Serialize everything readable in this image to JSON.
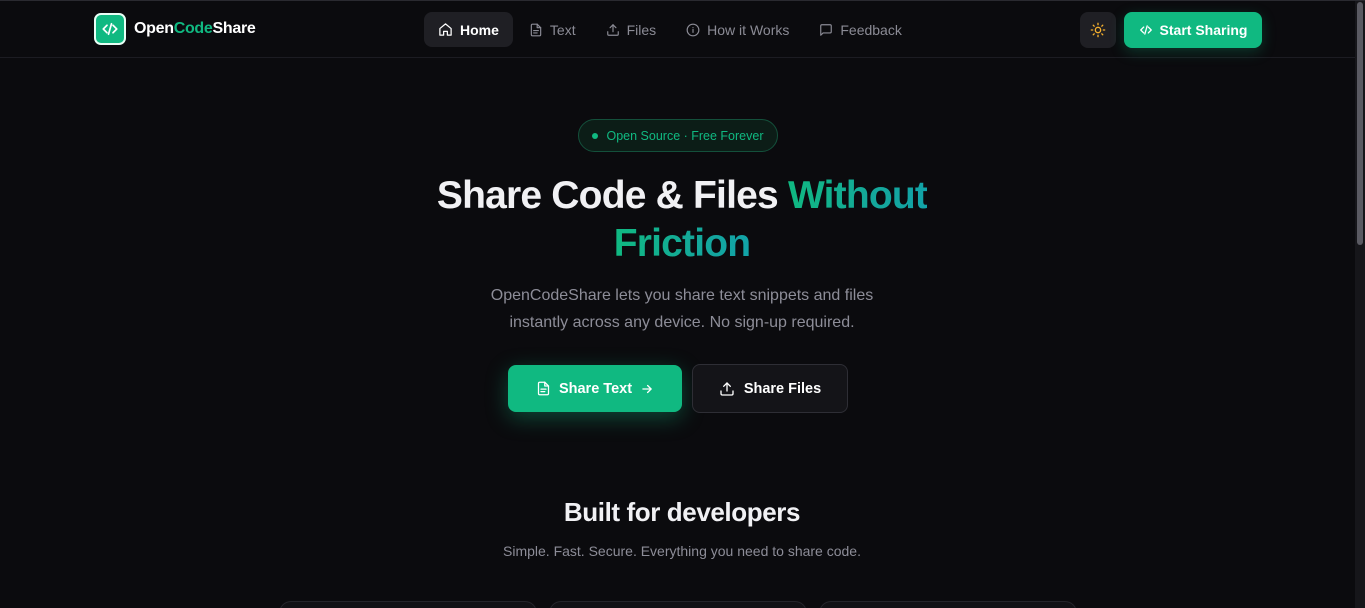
{
  "header": {
    "logo": {
      "part1": "Open",
      "part2": "Code",
      "part3": "Share",
      "icon": "code-icon"
    },
    "nav": [
      {
        "label": "Home",
        "icon": "home-icon",
        "active": true
      },
      {
        "label": "Text",
        "icon": "file-text-icon",
        "active": false
      },
      {
        "label": "Files",
        "icon": "upload-icon",
        "active": false
      },
      {
        "label": "How it Works",
        "icon": "info-icon",
        "active": false
      },
      {
        "label": "Feedback",
        "icon": "message-icon",
        "active": false
      }
    ],
    "theme_toggle_icon": "sun-icon",
    "cta_label": "Start Sharing"
  },
  "hero": {
    "badge": "Open Source · Free Forever",
    "title_plain": "Share Code & Files ",
    "title_highlight_1": "Without",
    "title_highlight_2": "Friction",
    "subtitle_line1": "OpenCodeShare lets you share text snippets and files",
    "subtitle_line2": "instantly across any device. No sign-up required.",
    "primary_button": "Share Text",
    "secondary_button": "Share Files"
  },
  "features": {
    "title": "Built for developers",
    "subtitle": "Simple. Fast. Secure. Everything you need to share code."
  },
  "colors": {
    "accent": "#10b981",
    "accent_teal": "#12a3a8",
    "background": "#0b0b0e",
    "surface": "#1f1f24",
    "muted_text": "#8d8d98"
  }
}
